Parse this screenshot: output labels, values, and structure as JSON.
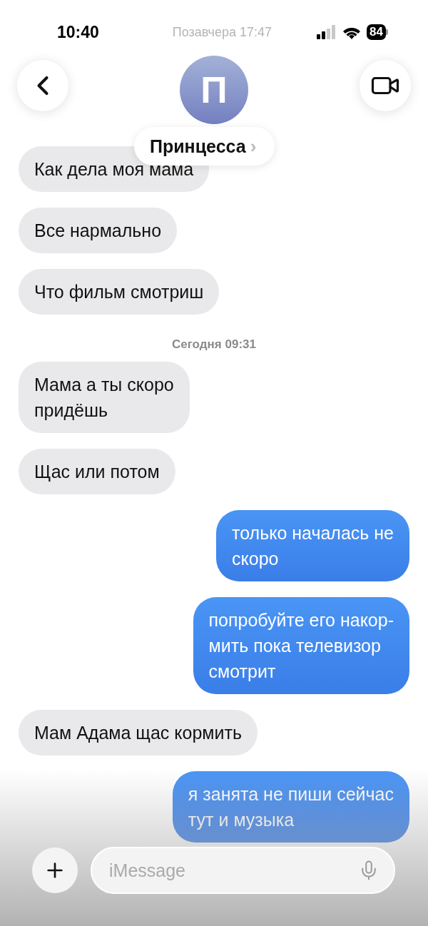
{
  "status_bar": {
    "time": "10:40",
    "faded_timestamp": "Позавчера 17:47",
    "battery": "84"
  },
  "header": {
    "avatar_initial": "П",
    "contact_name": "Принцесса",
    "chevron": "›"
  },
  "messages": [
    {
      "kind": "received",
      "text": "Как дела моя мама"
    },
    {
      "kind": "received",
      "text": "Все нармально"
    },
    {
      "kind": "received",
      "text": "Что фильм смотриш"
    },
    {
      "kind": "timestamp",
      "text": "Сегодня 09:31"
    },
    {
      "kind": "received",
      "text": "Мама а ты скоро\nпридёшь"
    },
    {
      "kind": "received",
      "text": "Щас или потом"
    },
    {
      "kind": "sent",
      "text": "только началась не\nскоро"
    },
    {
      "kind": "sent",
      "text": "попробуйте его накор-\nмить пока телевизор\nсмотрит"
    },
    {
      "kind": "received",
      "text": "Мам Адама щас кормить"
    },
    {
      "kind": "sent",
      "text": "я занята не пиши сейчас\nтут и музыка"
    }
  ],
  "composer": {
    "placeholder": "iMessage"
  }
}
